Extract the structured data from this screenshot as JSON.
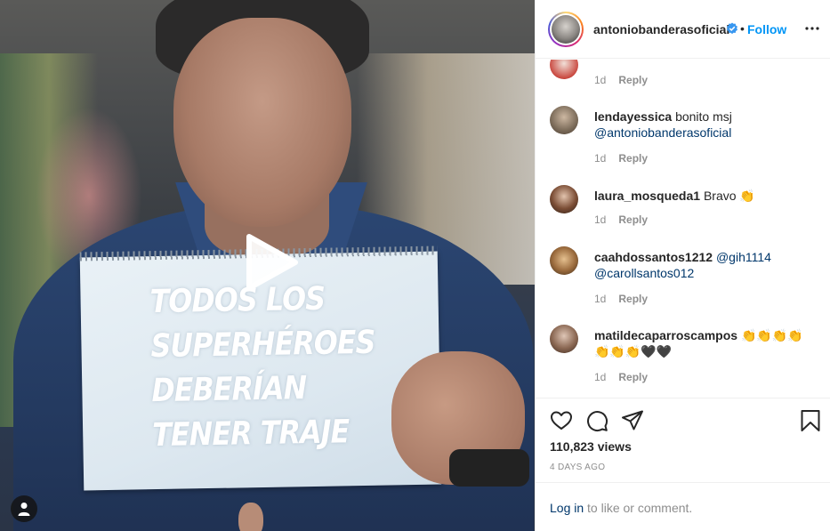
{
  "post": {
    "author": "antoniobanderasoficial",
    "separator": "•",
    "follow_label": "Follow",
    "overlay_lines": [
      "TODOS LOS",
      "SUPERHÉROES",
      "DEBERÍAN",
      "TENER TRAJE"
    ]
  },
  "comments": [
    {
      "user": "",
      "text": "",
      "age": "1d",
      "reply": "Reply",
      "partial": true
    },
    {
      "user": "lendayessica",
      "text": "bonito msj",
      "mention": "@antoniobanderasoficial",
      "age": "1d",
      "reply": "Reply"
    },
    {
      "user": "laura_mosqueda1",
      "text": "Bravo 👏",
      "age": "1d",
      "reply": "Reply"
    },
    {
      "user": "caahdossantos1212",
      "mention": "@gih1114",
      "mention2": "@carollsantos012",
      "age": "1d",
      "reply": "Reply"
    },
    {
      "user": "matildecaparroscampos",
      "text": "👏👏👏👏👏👏👏🖤🖤",
      "age": "1d",
      "reply": "Reply"
    }
  ],
  "stats": {
    "views": "110,823 views",
    "posted": "4 DAYS AGO"
  },
  "login": {
    "link": "Log in",
    "rest": " to like or comment."
  },
  "icons": {
    "play": "play-icon",
    "user_tag": "user-tag-icon",
    "verified": "verified-badge-icon",
    "more": "more-options-icon",
    "like": "heart-icon",
    "comment": "comment-icon",
    "share": "share-icon",
    "save": "bookmark-icon"
  },
  "colors": {
    "follow": "#0095f6",
    "mention": "#00376b",
    "muted": "#8e8e8e",
    "text": "#262626"
  }
}
